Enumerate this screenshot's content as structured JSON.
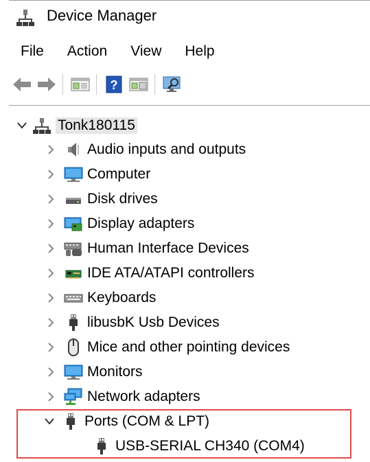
{
  "window": {
    "title": "Device Manager"
  },
  "menu": [
    "File",
    "Action",
    "View",
    "Help"
  ],
  "tree": {
    "root": "Tonk180115",
    "categories": [
      {
        "label": "Audio inputs and outputs",
        "icon": "speaker-icon"
      },
      {
        "label": "Computer",
        "icon": "monitor-icon"
      },
      {
        "label": "Disk drives",
        "icon": "disk-drive-icon"
      },
      {
        "label": "Display adapters",
        "icon": "display-adapter-icon"
      },
      {
        "label": "Human Interface Devices",
        "icon": "hid-icon"
      },
      {
        "label": "IDE ATA/ATAPI controllers",
        "icon": "ide-controller-icon"
      },
      {
        "label": "Keyboards",
        "icon": "keyboard-icon"
      },
      {
        "label": "libusbK Usb Devices",
        "icon": "usb-plug-icon"
      },
      {
        "label": "Mice and other pointing devices",
        "icon": "mouse-icon"
      },
      {
        "label": "Monitors",
        "icon": "monitor-icon"
      },
      {
        "label": "Network adapters",
        "icon": "network-adapter-icon"
      },
      {
        "label": "Ports (COM & LPT)",
        "icon": "port-icon",
        "expanded": true
      }
    ],
    "port_child": "USB-SERIAL CH340 (COM4)"
  },
  "colors": {
    "highlight": "#e04a4a",
    "accent": "#1f74c9"
  }
}
